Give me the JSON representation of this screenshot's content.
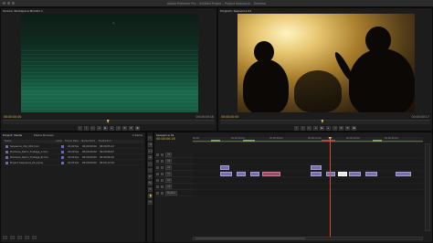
{
  "window": {
    "title": "Adobe Premiere Pro – Untitled Project – Project Sequence – Timeline"
  },
  "source_monitor": {
    "tab_label": "Source: Workspace Monitor 1",
    "timecode_in": "00:00:00:00",
    "timecode_out": "00:00:00:16",
    "playhead_position_pct": 49
  },
  "program_monitor": {
    "tab_label": "Program: Sequence 01",
    "timecode_in": "00:00:00:00",
    "timecode_out": "00:00:00:17",
    "playhead_position_pct": 48
  },
  "transport_buttons": [
    "mark-in",
    "mark-out",
    "go-to-in",
    "step-back",
    "play",
    "step-forward",
    "go-to-out",
    "insert",
    "overwrite",
    "export-frame"
  ],
  "project": {
    "tab_label": "Project: Media",
    "sub_tab": "Media Browser",
    "count": "4 Items",
    "columns": [
      "Name",
      "Label",
      "Frame Rate",
      "Media Start",
      "Media End"
    ],
    "items": [
      {
        "name": "Sequence_Clip_001.mov",
        "rate": "24.00 fps",
        "start": "00:00:00:00",
        "end": "00:00:05:12"
      },
      {
        "name": "Premiere_Demo_Footage_A.mov",
        "rate": "24.00 fps",
        "start": "00:00:00:00",
        "end": "00:00:08:03"
      },
      {
        "name": "Premiere_Demo_Footage_B.mov",
        "rate": "24.00 fps",
        "start": "00:00:00:00",
        "end": "00:00:06:20"
      },
      {
        "name": "Project_Sequence_01.prproj",
        "rate": "24.00 fps",
        "start": "00:00:00:00",
        "end": "00:00:12:10"
      }
    ]
  },
  "tools": [
    "select",
    "track-select",
    "ripple",
    "rolling",
    "rate-stretch",
    "razor",
    "slip",
    "slide",
    "pen",
    "hand",
    "zoom"
  ],
  "timeline": {
    "tab_label": "Sequence 01",
    "timecode": "00:00:00:16",
    "ruler_labels": [
      "00:00",
      "00:00:04:00",
      "00:00:08:00",
      "00:00:12:00",
      "00:00:16:00",
      "00:00:20:00"
    ],
    "playhead_pct": 59,
    "tracks": [
      {
        "id": "V3",
        "kind": "video"
      },
      {
        "id": "V2",
        "kind": "video"
      },
      {
        "id": "V1",
        "kind": "video"
      },
      {
        "id": "A1",
        "kind": "audio"
      },
      {
        "id": "A2",
        "kind": "audio"
      },
      {
        "id": "A3",
        "kind": "audio"
      },
      {
        "id": "Master",
        "kind": "master"
      }
    ],
    "clips": [
      {
        "track": 2,
        "start_pct": 12,
        "end_pct": 16,
        "kind": "video"
      },
      {
        "track": 3,
        "start_pct": 12,
        "end_pct": 17,
        "kind": "video"
      },
      {
        "track": 3,
        "start_pct": 19,
        "end_pct": 23,
        "kind": "video"
      },
      {
        "track": 3,
        "start_pct": 25,
        "end_pct": 29,
        "kind": "video"
      },
      {
        "track": 3,
        "start_pct": 30,
        "end_pct": 38,
        "kind": "audio-pink"
      },
      {
        "track": 2,
        "start_pct": 51,
        "end_pct": 56,
        "kind": "video"
      },
      {
        "track": 3,
        "start_pct": 51,
        "end_pct": 56,
        "kind": "video"
      },
      {
        "track": 3,
        "start_pct": 58,
        "end_pct": 62,
        "kind": "video"
      },
      {
        "track": 3,
        "start_pct": 63,
        "end_pct": 67,
        "kind": "selected"
      },
      {
        "track": 3,
        "start_pct": 68,
        "end_pct": 73,
        "kind": "video"
      },
      {
        "track": 3,
        "start_pct": 75,
        "end_pct": 80,
        "kind": "video"
      },
      {
        "track": 3,
        "start_pct": 88,
        "end_pct": 95,
        "kind": "video"
      }
    ]
  }
}
